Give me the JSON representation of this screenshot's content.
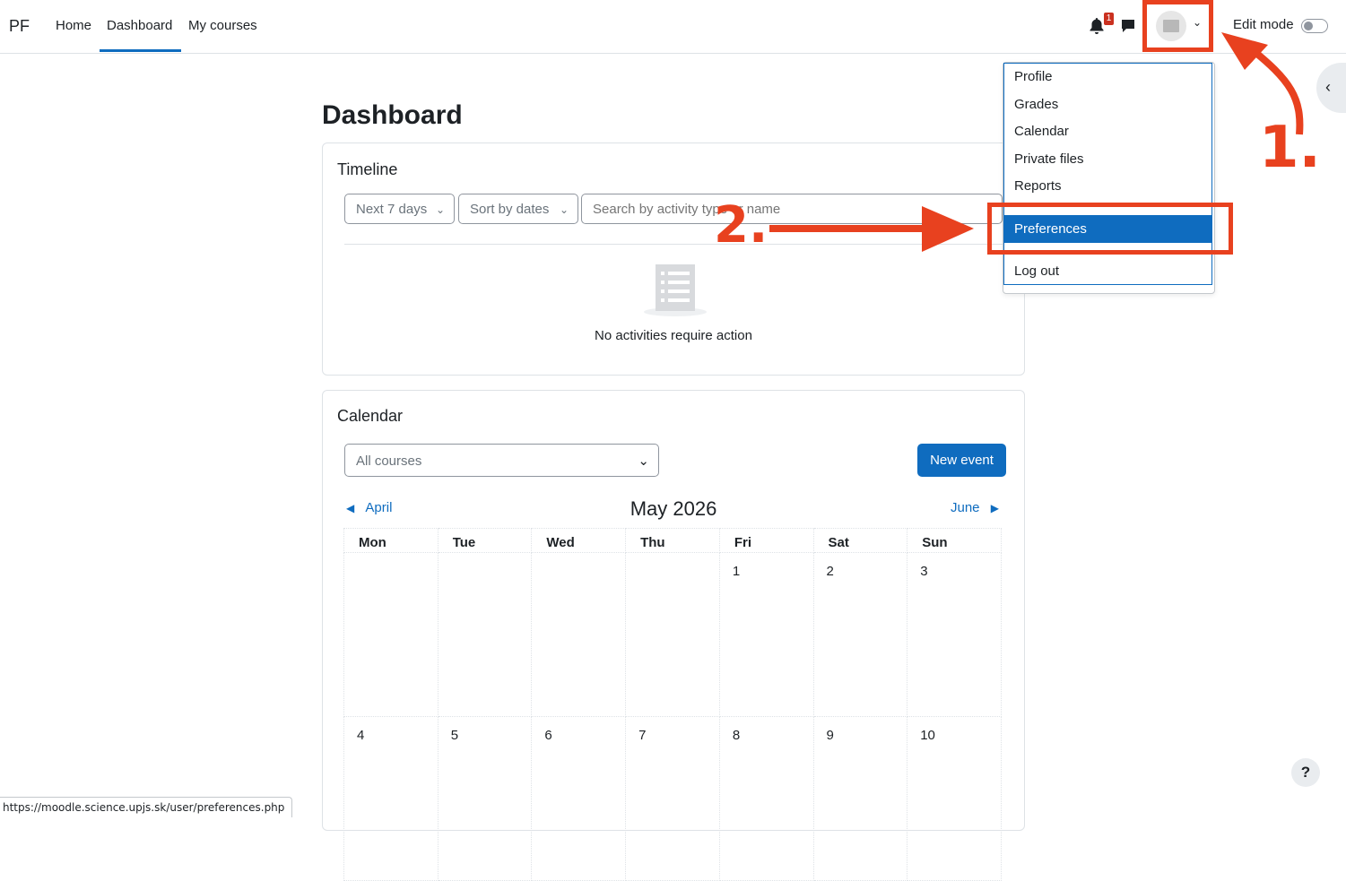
{
  "navbar": {
    "brand": "PF",
    "links": [
      "Home",
      "Dashboard",
      "My courses"
    ],
    "active_link": "Dashboard",
    "notification_count": "1",
    "edit_mode_label": "Edit mode"
  },
  "page": {
    "title": "Dashboard"
  },
  "timeline": {
    "title": "Timeline",
    "range_select": "Next 7 days",
    "sort_select": "Sort by dates",
    "search_placeholder": "Search by activity type or name",
    "empty_message": "No activities require action"
  },
  "calendar": {
    "title": "Calendar",
    "course_select": "All courses",
    "new_event_label": "New event",
    "prev_month": "April",
    "next_month": "June",
    "current_month": "May 2026",
    "weekdays": [
      "Mon",
      "Tue",
      "Wed",
      "Thu",
      "Fri",
      "Sat",
      "Sun"
    ],
    "weeks": [
      [
        "",
        "",
        "",
        "",
        "1",
        "2",
        "3"
      ],
      [
        "4",
        "5",
        "6",
        "7",
        "8",
        "9",
        "10"
      ]
    ]
  },
  "user_menu": {
    "items": [
      "Profile",
      "Grades",
      "Calendar",
      "Private files",
      "Reports",
      "Preferences",
      "Log out"
    ],
    "highlighted": "Preferences"
  },
  "annotations": {
    "step1": "1.",
    "step2": "2.",
    "color": "#e8411f"
  },
  "status_bar": {
    "url": "https://moodle.science.upjs.sk/user/preferences.php"
  },
  "help": {
    "label": "?"
  },
  "colors": {
    "primary": "#0f6cbf",
    "badge": "#ca3120"
  }
}
